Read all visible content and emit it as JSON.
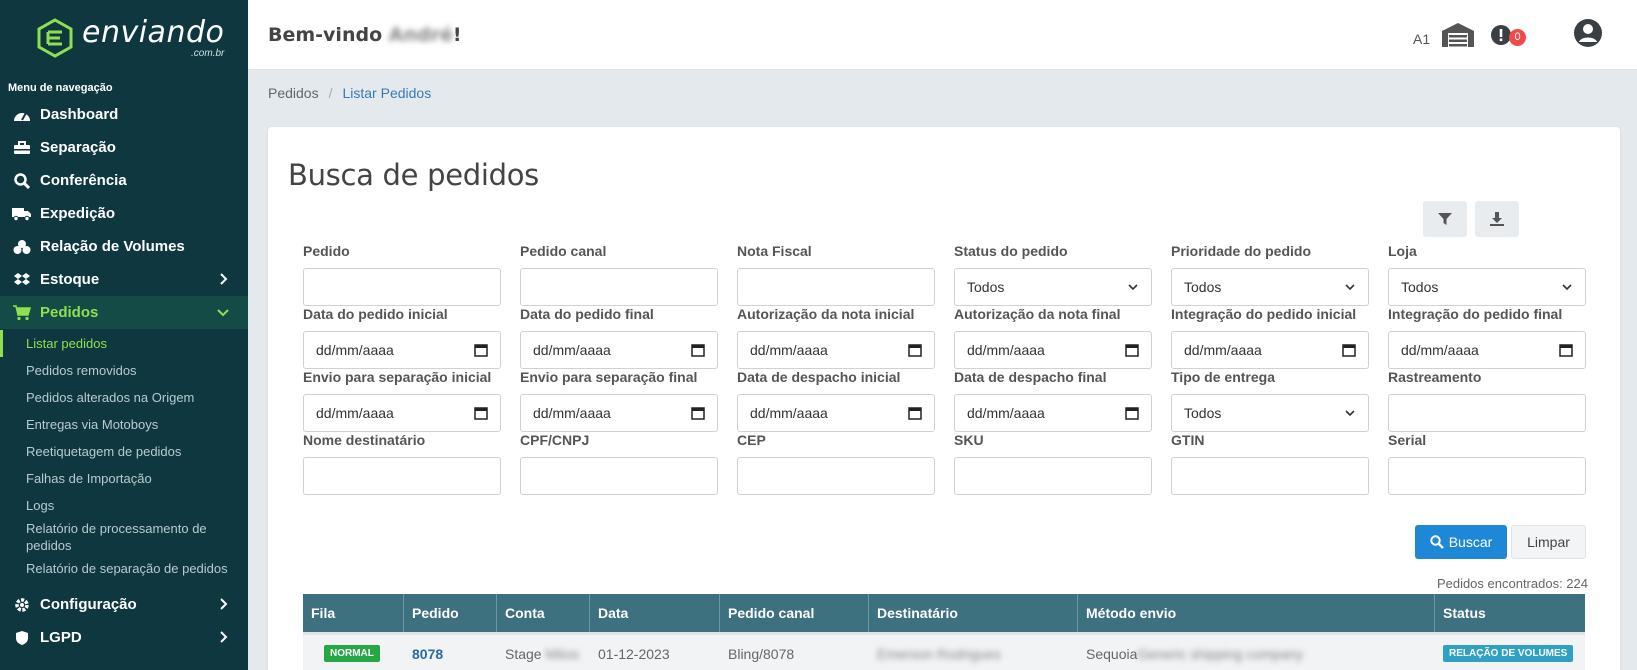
{
  "brand": {
    "name": "enviando",
    "domain": ".com.br",
    "accent": "#8fe04e",
    "sidebar_bg": "#0f3740"
  },
  "sidebar": {
    "section_title": "Menu de navegação",
    "items": [
      {
        "label": "Dashboard",
        "icon": "gauge-icon"
      },
      {
        "label": "Separação",
        "icon": "toolbox-icon"
      },
      {
        "label": "Conferência",
        "icon": "search-icon"
      },
      {
        "label": "Expedição",
        "icon": "truck-icon"
      },
      {
        "label": "Relação de Volumes",
        "icon": "boxes-icon"
      },
      {
        "label": "Estoque",
        "icon": "dropbox-icon"
      },
      {
        "label": "Pedidos",
        "icon": "cart-icon"
      },
      {
        "label": "Configuração",
        "icon": "gear-icon"
      },
      {
        "label": "LGPD",
        "icon": "shield-icon"
      }
    ],
    "subitems": [
      "Listar pedidos",
      "Pedidos removidos",
      "Pedidos alterados na Origem",
      "Entregas via Motoboys",
      "Reetiquetagem de pedidos",
      "Falhas de Importação",
      "Logs",
      "Relatório de processamento de pedidos",
      "Relatório de separação de pedidos"
    ]
  },
  "header": {
    "welcome_prefix": "Bem-vindo ",
    "welcome_name": "André",
    "welcome_suffix": "!",
    "warehouse_code": "A1",
    "alert_count": "0"
  },
  "breadcrumb": {
    "root": "Pedidos",
    "sep": "/",
    "current": "Listar Pedidos"
  },
  "page": {
    "title": "Busca de pedidos",
    "search_label": "Buscar",
    "clear_label": "Limpar",
    "found_text": "Pedidos encontrados: 224"
  },
  "filters": {
    "row1": [
      {
        "label": "Pedido",
        "value": "",
        "kind": "text"
      },
      {
        "label": "Pedido canal",
        "value": "",
        "kind": "text"
      },
      {
        "label": "Nota Fiscal",
        "value": "",
        "kind": "text"
      },
      {
        "label": "Status do pedido",
        "value": "Todos",
        "kind": "select"
      },
      {
        "label": "Prioridade do pedido",
        "value": "Todos",
        "kind": "select"
      },
      {
        "label": "Loja",
        "value": "Todos",
        "kind": "select"
      }
    ],
    "row2": [
      {
        "label": "Data do pedido inicial",
        "value": "dd/mm/aaaa",
        "kind": "date"
      },
      {
        "label": "Data do pedido final",
        "value": "dd/mm/aaaa",
        "kind": "date"
      },
      {
        "label": "Autorização da nota inicial",
        "value": "dd/mm/aaaa",
        "kind": "date"
      },
      {
        "label": "Autorização da nota final",
        "value": "dd/mm/aaaa",
        "kind": "date"
      },
      {
        "label": "Integração do pedido inicial",
        "value": "dd/mm/aaaa",
        "kind": "date"
      },
      {
        "label": "Integração do pedido final",
        "value": "dd/mm/aaaa",
        "kind": "date"
      }
    ],
    "row3": [
      {
        "label": "Envio para separação inicial",
        "value": "dd/mm/aaaa",
        "kind": "date"
      },
      {
        "label": "Envio para separação final",
        "value": "dd/mm/aaaa",
        "kind": "date"
      },
      {
        "label": "Data de despacho inicial",
        "value": "dd/mm/aaaa",
        "kind": "date"
      },
      {
        "label": "Data de despacho final",
        "value": "dd/mm/aaaa",
        "kind": "date"
      },
      {
        "label": "Tipo de entrega",
        "value": "Todos",
        "kind": "select"
      },
      {
        "label": "Rastreamento",
        "value": "",
        "kind": "text"
      }
    ],
    "row4": [
      {
        "label": "Nome destinatário",
        "value": "",
        "kind": "text"
      },
      {
        "label": "CPF/CNPJ",
        "value": "",
        "kind": "text"
      },
      {
        "label": "CEP",
        "value": "",
        "kind": "text"
      },
      {
        "label": "SKU",
        "value": "",
        "kind": "text"
      },
      {
        "label": "GTIN",
        "value": "",
        "kind": "text"
      },
      {
        "label": "Serial",
        "value": "",
        "kind": "text"
      }
    ]
  },
  "table": {
    "columns": [
      "Fila",
      "Pedido",
      "Conta",
      "Data",
      "Pedido canal",
      "Destinatário",
      "Método envio",
      "Status"
    ],
    "rows": [
      {
        "fila": "NORMAL",
        "pedido": "8078",
        "conta": "Stage",
        "conta_hidden": "Mitos",
        "data": "01-12-2023",
        "pedido_canal": "Bling/8078",
        "destinatario_hidden": "Emerson Rodrigues",
        "metodo": "Sequoia",
        "metodo_hidden": " Generic shipping company",
        "status": "RELAÇÃO DE VOLUMES"
      }
    ]
  }
}
